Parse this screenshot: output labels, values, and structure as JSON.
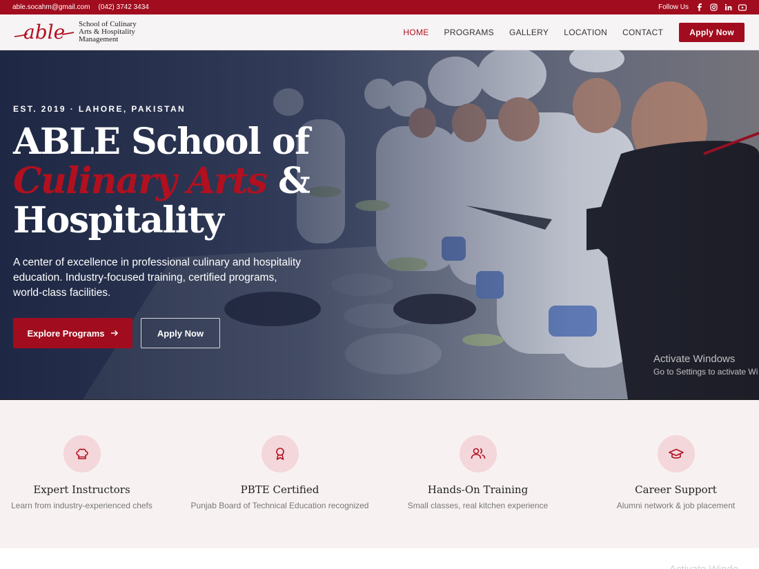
{
  "topbar": {
    "email": "able.socahm@gmail.com",
    "phone": "(042) 3742 3434",
    "follow_label": "Follow Us",
    "social_icons": [
      "facebook-icon",
      "instagram-icon",
      "linkedin-icon",
      "youtube-icon"
    ]
  },
  "logo": {
    "script": "able",
    "line1": "School of Culinary",
    "line2": "Arts & Hospitality",
    "line3": "Management"
  },
  "nav": {
    "items": [
      {
        "label": "HOME",
        "active": true
      },
      {
        "label": "PROGRAMS",
        "active": false
      },
      {
        "label": "GALLERY",
        "active": false
      },
      {
        "label": "LOCATION",
        "active": false
      },
      {
        "label": "CONTACT",
        "active": false
      }
    ],
    "apply_label": "Apply Now"
  },
  "hero": {
    "eyebrow": "EST. 2019 · LAHORE, PAKISTAN",
    "title_line1": "ABLE School of",
    "title_accent": "Culinary Arts",
    "title_amp": " &",
    "title_line3": "Hospitality",
    "description": "A center of excellence in professional culinary and hospitality education. Industry-focused training, certified programs, world-class facilities.",
    "primary_button": "Explore Programs",
    "primary_icon": "arrow-right-icon",
    "secondary_button": "Apply Now"
  },
  "watermark": {
    "title": "Activate Windows",
    "subtitle": "Go to Settings to activate Wi",
    "bottom": "Activate Windo"
  },
  "features": [
    {
      "icon": "chef-hat-icon",
      "title": "Expert Instructors",
      "desc": "Learn from industry-experienced chefs"
    },
    {
      "icon": "award-ribbon-icon",
      "title": "PBTE Certified",
      "desc": "Punjab Board of Technical Education recognized"
    },
    {
      "icon": "users-icon",
      "title": "Hands-On Training",
      "desc": "Small classes, real kitchen experience"
    },
    {
      "icon": "graduation-cap-icon",
      "title": "Career Support",
      "desc": "Alumni network & job placement"
    }
  ],
  "colors": {
    "brand_red": "#a10d1e",
    "accent_red": "#b2101f",
    "hero_overlay": "#1a233e",
    "feature_bg": "#f8f1f2",
    "icon_circle": "#f3d7da"
  }
}
